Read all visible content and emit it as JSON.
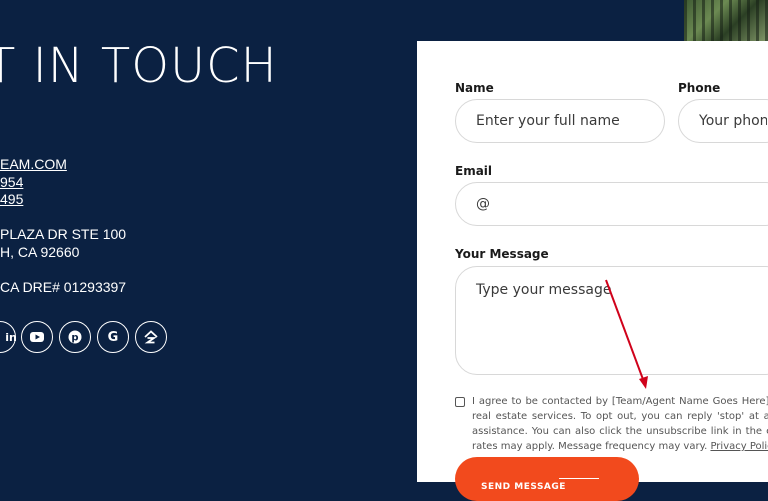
{
  "left": {
    "title": "T IN TOUCH",
    "contacts": {
      "email_text": "EAM.COM",
      "phone1_text": "954",
      "phone2_text": "495",
      "address_line1": "PLAZA DR STE 100",
      "address_line2": "H, CA 92660",
      "license": "CA DRE# 01293397"
    },
    "social_icons": [
      "linkedin-icon",
      "youtube-icon",
      "pinterest-icon",
      "google-icon",
      "zillow-icon"
    ]
  },
  "form": {
    "name_label": "Name",
    "name_placeholder": "Enter your full name",
    "phone_label": "Phone",
    "phone_placeholder": "Your phone",
    "email_label": "Email",
    "email_placeholder": "@",
    "message_label": "Your Message",
    "message_placeholder": "Type your message",
    "consent_text": "I agree to be contacted by [Team/Agent Name Goes Here] vi real estate services. To opt out, you can reply 'stop' at any assistance. You can also click the unsubscribe link in the em rates may apply. Message frequency may vary.",
    "privacy_link": "Privacy Policy",
    "send_label": "SEND MESSAGE"
  },
  "colors": {
    "background": "#0b2142",
    "accent": "#f24a1d",
    "annotation_arrow": "#d0021b"
  }
}
